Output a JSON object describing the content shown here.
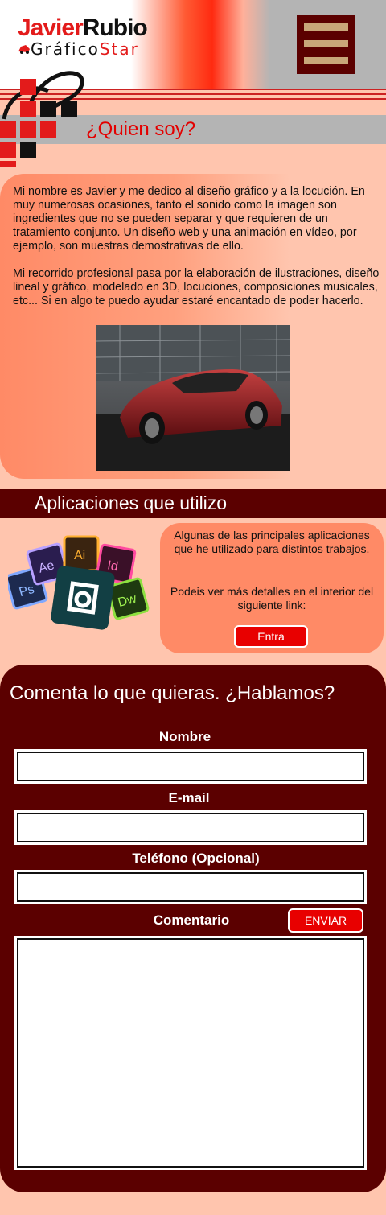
{
  "header": {
    "logo_name_first": "Javier",
    "logo_name_last": "Rubio",
    "logo_sub_first": "Gráfico",
    "logo_sub_second": "Star",
    "menu_icon": "hamburger-menu-icon"
  },
  "about": {
    "title": "¿Quien soy?",
    "paragraph1": "Mi nombre es Javier y me dedico al diseño gráfico y a la locución. En muy numerosas ocasiones, tanto el sonido como la imagen son ingredientes que no se pueden separar y que requieren de un tratamiento conjunto. Un diseño web y una animación en vídeo, por ejemplo, son muestras demostrativas de ello.",
    "paragraph2": "Mi recorrido profesional pasa por la elaboración de ilustraciones, diseño lineal y gráfico, modelado en 3D, locuciones, composiciones musicales, etc... Si en algo te puedo ayudar estaré encantado de poder hacerlo."
  },
  "apps": {
    "title": "Aplicaciones que utilizo",
    "icon_labels": [
      "Ps",
      "Ae",
      "Ai",
      "Id",
      "Dw"
    ],
    "text1": "Algunas de las principales aplicaciones que he utilizado para distintos trabajos.",
    "text2": "Podeis ver más detalles en el interior del siguiente link:",
    "button_label": "Entra"
  },
  "contact": {
    "title": "Comenta lo que quieras. ¿Hablamos?",
    "name_label": "Nombre",
    "email_label": "E-mail",
    "phone_label": "Teléfono (Opcional)",
    "comment_label": "Comentario",
    "send_label": "ENVIAR"
  },
  "colors": {
    "page_bg": "#ffc5ae",
    "dark_red": "#5b0000",
    "accent_red": "#e80000",
    "salmon": "#ff8a66",
    "gray": "#b4b4b4"
  }
}
